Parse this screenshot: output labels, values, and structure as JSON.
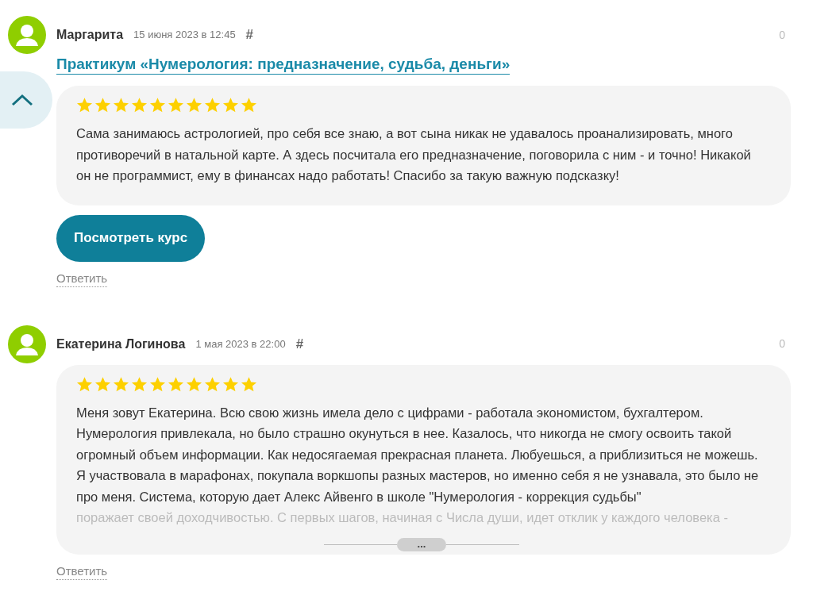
{
  "scroll_button": {
    "expanded": true
  },
  "reviews": [
    {
      "author": "Маргарита",
      "date": "15 июня 2023 в 12:45",
      "anchor": "#",
      "votes": "0",
      "course_link": "Практикум «Нумерология: предназначение, судьба, деньги»",
      "stars": 10,
      "text": "Сама занимаюсь астрологией, про себя все знаю, а вот сына никак не удавалось проанализировать, много противоречий в натальной карте. А здесь посчитала его предназначение, поговорила с ним - и точно! Никакой он не программист, ему в финансах надо работать! Спасибо за такую важную подсказку!",
      "button": "Посмотреть курс",
      "reply": "Ответить"
    },
    {
      "author": "Екатерина Логинова",
      "date": "1 мая 2023 в 22:00",
      "anchor": "#",
      "votes": "0",
      "stars": 10,
      "text": "Меня зовут Екатерина. Всю свою жизнь имела дело с цифрами - работала экономистом, бухгалтером. Нумерология привлекала, но было страшно окунуться в нее. Казалось, что никогда не смогу освоить такой огромный объем информации. Как недосягаемая прекрасная планета. Любуешься, а приблизиться не можешь. Я участвовала в марафонах, покупала воркшопы разных мастеров, но именно себя я не узнавала, это было не про меня. Система, которую дает Алекс Айвенго в школе \"Нумерология - коррекция судьбы\"",
      "faded_text": "поражает своей доходчивостью. С первых шагов, начиная с Числа души, идет отклик у каждого человека -",
      "expand_label": "...",
      "reply": "Ответить"
    }
  ]
}
